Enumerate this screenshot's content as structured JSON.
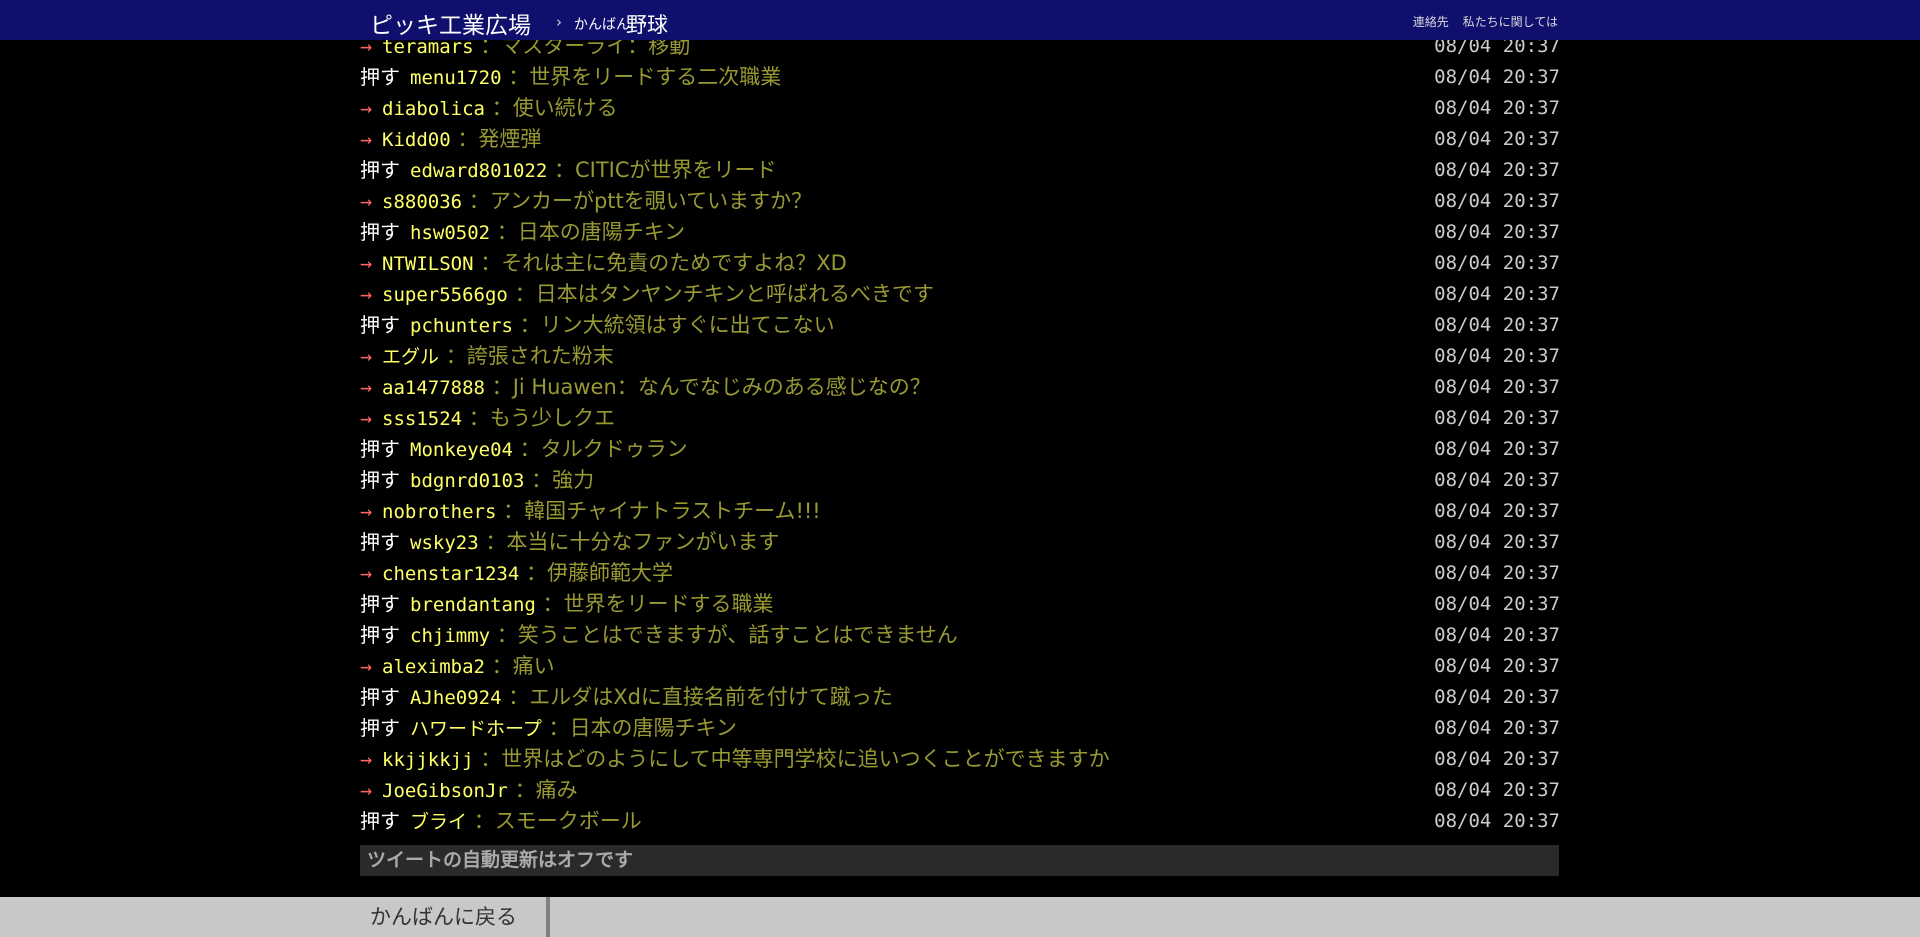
{
  "header": {
    "brand": "ピッキ工業広場",
    "separator": "›",
    "board_prefix": "かんばん",
    "board_name": "野球",
    "links": [
      "連絡先",
      "私たちに関しては"
    ]
  },
  "pushes": [
    {
      "type": "→",
      "user": "teramars",
      "text": "マスターライ：移動",
      "time": "08/04 20:37"
    },
    {
      "type": "押す",
      "user": "menu1720",
      "text": "世界をリードする二次職業",
      "time": "08/04 20:37"
    },
    {
      "type": "→",
      "user": "diabolica",
      "text": "使い続ける",
      "time": "08/04 20:37"
    },
    {
      "type": "→",
      "user": "Kidd00",
      "text": "発煙弾",
      "time": "08/04 20:37"
    },
    {
      "type": "押す",
      "user": "edward801022",
      "text": "CITICが世界をリード",
      "time": "08/04 20:37"
    },
    {
      "type": "→",
      "user": "s880036",
      "text": "アンカーがpttを覗いていますか？",
      "time": "08/04 20:37"
    },
    {
      "type": "押す",
      "user": "hsw0502",
      "text": "日本の唐陽チキン",
      "time": "08/04 20:37"
    },
    {
      "type": "→",
      "user": "NTWILSON",
      "text": "それは主に免責のためですよね？XD",
      "time": "08/04 20:37"
    },
    {
      "type": "→",
      "user": "super5566go",
      "text": "日本はタンヤンチキンと呼ばれるべきです",
      "time": "08/04 20:37"
    },
    {
      "type": "押す",
      "user": "pchunters",
      "text": "リン大統領はすぐに出てこない",
      "time": "08/04 20:37"
    },
    {
      "type": "→",
      "user": "エグル",
      "text": "誇張された粉末",
      "time": "08/04 20:37"
    },
    {
      "type": "→",
      "user": "aa1477888",
      "text": "Ji Huawen：なんでなじみのある感じなの？",
      "time": "08/04 20:37"
    },
    {
      "type": "→",
      "user": "sss1524",
      "text": "もう少しクエ",
      "time": "08/04 20:37"
    },
    {
      "type": "押す",
      "user": "Monkeye04",
      "text": "タルクドゥラン",
      "time": "08/04 20:37"
    },
    {
      "type": "押す",
      "user": "bdgnrd0103",
      "text": "強力",
      "time": "08/04 20:37"
    },
    {
      "type": "→",
      "user": "nobrothers",
      "text": "韓国チャイナトラストチーム!!!",
      "time": "08/04 20:37"
    },
    {
      "type": "押す",
      "user": "wsky23",
      "text": "本当に十分なファンがいます",
      "time": "08/04 20:37"
    },
    {
      "type": "→",
      "user": "chenstar1234",
      "text": "伊藤師範大学",
      "time": "08/04 20:37"
    },
    {
      "type": "押す",
      "user": "brendantang",
      "text": "世界をリードする職業",
      "time": "08/04 20:37"
    },
    {
      "type": "押す",
      "user": "chjimmy",
      "text": "笑うことはできますが、話すことはできません",
      "time": "08/04 20:37"
    },
    {
      "type": "→",
      "user": "aleximba2",
      "text": "痛い",
      "time": "08/04 20:37"
    },
    {
      "type": "押す",
      "user": "AJhe0924",
      "text": "エルダはXdに直接名前を付けて蹴った",
      "time": "08/04 20:37"
    },
    {
      "type": "押す",
      "user": "ハワードホープ",
      "text": "日本の唐陽チキン",
      "time": "08/04 20:37"
    },
    {
      "type": "→",
      "user": "kkjjkkjj",
      "text": "世界はどのようにして中等専門学校に追いつくことができますか",
      "time": "08/04 20:37"
    },
    {
      "type": "→",
      "user": "JoeGibsonJr",
      "text": "痛み",
      "time": "08/04 20:37"
    },
    {
      "type": "押す",
      "user": "ブライ",
      "text": "スモークボール",
      "time": "08/04 20:37"
    }
  ],
  "status": {
    "autoupdate": "ツイートの自動更新はオフです"
  },
  "footer": {
    "back_label": "かんばんに戻る"
  },
  "colors": {
    "header_bg": "#0f0f6e",
    "arrow": "#ff6666",
    "user": "#ffff66",
    "message": "#999933",
    "footer_bg": "#c8c8c8"
  }
}
